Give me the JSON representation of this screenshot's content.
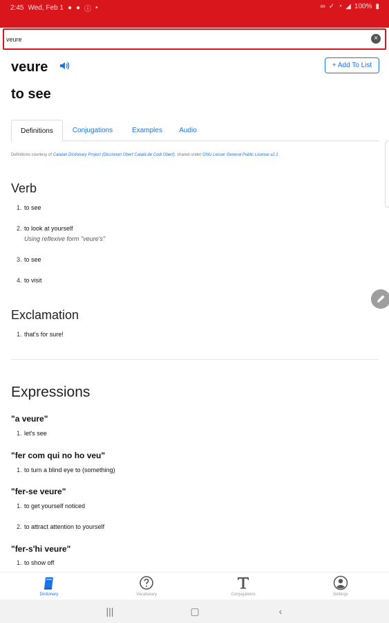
{
  "status": {
    "time": "2:45",
    "date": "Wed, Feb 1",
    "battery": "100%"
  },
  "search": {
    "value": "veure"
  },
  "entry": {
    "word": "veure",
    "translation": "to see",
    "add_to_list": "+ Add To List"
  },
  "tabs": [
    "Definitions",
    "Conjugations",
    "Examples",
    "Audio"
  ],
  "credit": {
    "prefix": "Definitions courtesy of",
    "source": "Catalan Dictionary Project (Diccionari Obert Català de Codi Obert)",
    "middle": ", shared under",
    "license": "GNU Lesser General Public License v2.1"
  },
  "sections": {
    "verb": {
      "heading": "Verb",
      "items": [
        {
          "num": "1.",
          "text": "to see"
        },
        {
          "num": "2.",
          "text": "to look at yourself",
          "note": "Using reflexive form \"veure's\""
        },
        {
          "num": "3.",
          "text": "to see"
        },
        {
          "num": "4.",
          "text": "to visit"
        }
      ]
    },
    "exclamation": {
      "heading": "Exclamation",
      "items": [
        {
          "num": "1.",
          "text": "that's for sure!"
        }
      ]
    }
  },
  "expressions": {
    "heading": "Expressions",
    "groups": [
      {
        "phrase": "\"a veure\"",
        "items": [
          {
            "num": "1.",
            "text": "let's see"
          }
        ]
      },
      {
        "phrase": "\"fer com qui no ho veu\"",
        "items": [
          {
            "num": "1.",
            "text": "to turn a blind eye to (something)"
          }
        ]
      },
      {
        "phrase": "\"fer-se veure\"",
        "items": [
          {
            "num": "1.",
            "text": "to get yourself noticed"
          },
          {
            "num": "2.",
            "text": "to attract attention to yourself"
          }
        ]
      },
      {
        "phrase": "\"fer-s'hi veure\"",
        "items": [
          {
            "num": "1.",
            "text": "to show off"
          }
        ]
      }
    ]
  },
  "bottom_nav": [
    {
      "label": "Dictionary",
      "icon": "book-icon"
    },
    {
      "label": "Vocabulary",
      "icon": "question-icon"
    },
    {
      "label": "Conjugations",
      "icon": "text-t-icon"
    },
    {
      "label": "Settings",
      "icon": "account-icon"
    }
  ],
  "colors": {
    "accent": "#1a73e8",
    "brand_red": "#d9161c"
  }
}
